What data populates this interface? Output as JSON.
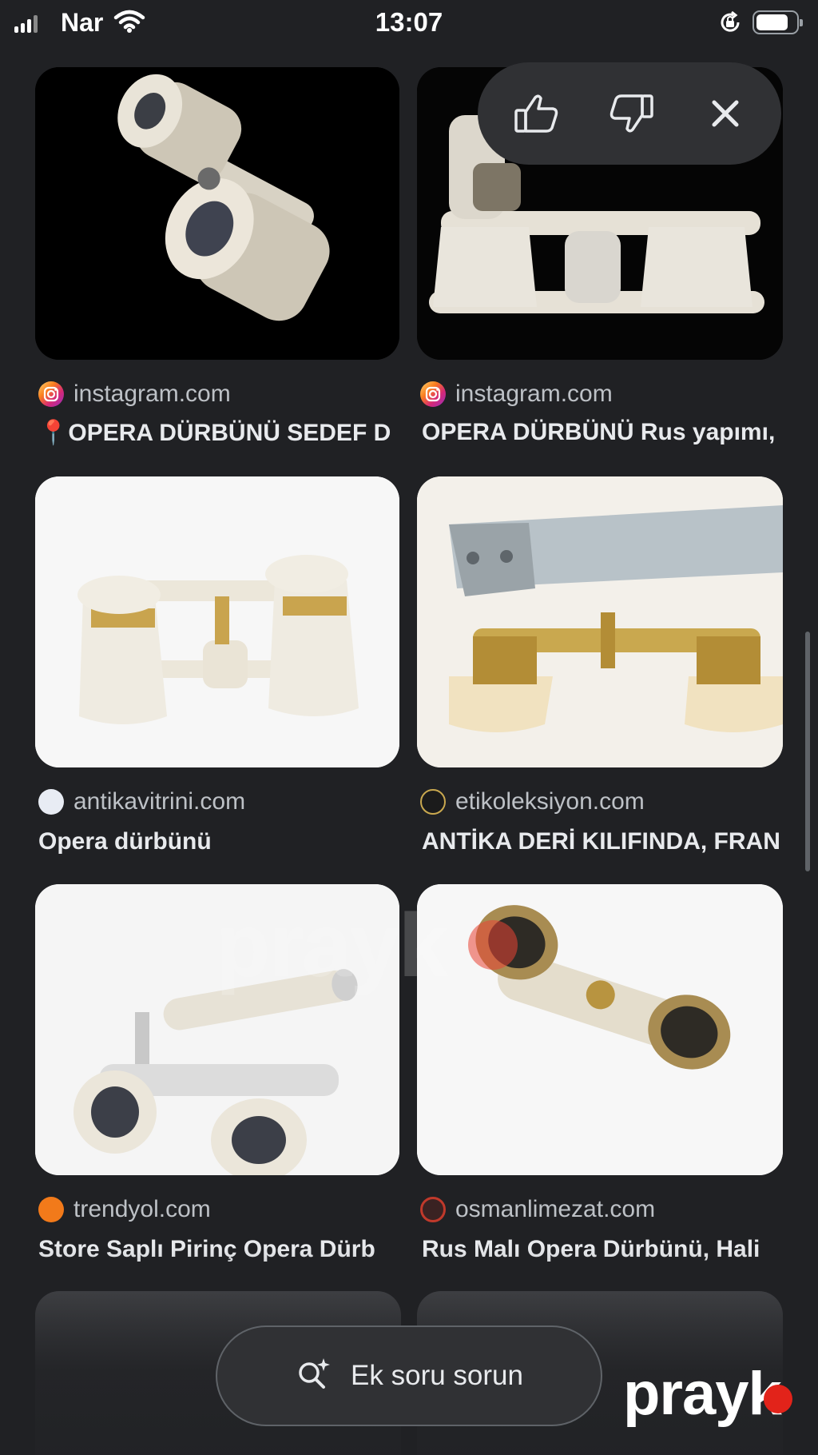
{
  "status_bar": {
    "carrier": "Nar",
    "time": "13:07"
  },
  "feedback_popup": {
    "icons": [
      "thumb-up-icon",
      "thumb-down-icon",
      "close-icon"
    ]
  },
  "results": [
    {
      "source": "instagram.com",
      "title": "📍OPERA DÜRBÜNÜ SEDEF D",
      "favicon": "instagram-icon"
    },
    {
      "source": "instagram.com",
      "title": "OPERA DÜRBÜNÜ Rus yapımı,",
      "favicon": "instagram-icon"
    },
    {
      "source": "antikavitrini.com",
      "title": "Opera dürbünü",
      "favicon": "antikavitrini-icon"
    },
    {
      "source": "etikoleksiyon.com",
      "title": "ANTİKA DERİ KILIFINDA, FRAN",
      "favicon": "etikoleksiyon-icon"
    },
    {
      "source": "trendyol.com",
      "title": "Store Saplı Pirinç Opera Dürb",
      "favicon": "trendyol-icon"
    },
    {
      "source": "osmanlimezat.com",
      "title": "Rus Malı Opera Dürbünü, Hali",
      "favicon": "osmanlimezat-icon"
    }
  ],
  "ask_button": {
    "label": "Ek soru sorun",
    "icon": "search-sparkle-icon"
  },
  "watermark": {
    "text": "prayk"
  },
  "colors": {
    "background": "#202124",
    "surface": "#303134",
    "text_primary": "#e8eaed",
    "text_secondary": "#bdc1c6",
    "watermark_dot": "#e2231a"
  }
}
